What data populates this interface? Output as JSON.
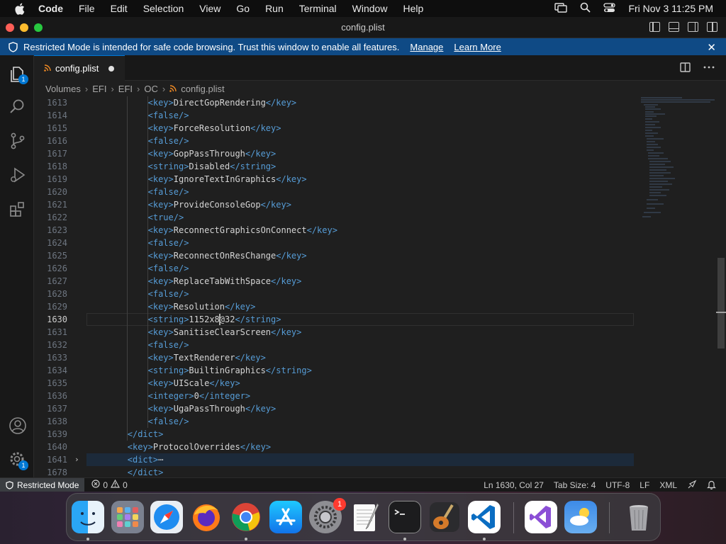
{
  "menubar": {
    "app": "Code",
    "items": [
      "File",
      "Edit",
      "Selection",
      "View",
      "Go",
      "Run",
      "Terminal",
      "Window",
      "Help"
    ],
    "clock": "Fri Nov 3  11:25 PM"
  },
  "window": {
    "title": "config.plist"
  },
  "banner": {
    "message": "Restricted Mode is intended for safe code browsing. Trust this window to enable all features.",
    "manage": "Manage",
    "learn_more": "Learn More"
  },
  "activity": {
    "explorer_badge": "1",
    "settings_badge": "1"
  },
  "tab": {
    "label": "config.plist"
  },
  "breadcrumb": [
    "Volumes",
    "EFI",
    "EFI",
    "OC",
    "config.plist"
  ],
  "editor": {
    "lines": [
      {
        "n": "1613",
        "indent": 3,
        "open": "<key>",
        "text": "DirectGopRendering",
        "close": "</key>"
      },
      {
        "n": "1614",
        "indent": 3,
        "open": "<false/>",
        "text": "",
        "close": ""
      },
      {
        "n": "1615",
        "indent": 3,
        "open": "<key>",
        "text": "ForceResolution",
        "close": "</key>"
      },
      {
        "n": "1616",
        "indent": 3,
        "open": "<false/>",
        "text": "",
        "close": ""
      },
      {
        "n": "1617",
        "indent": 3,
        "open": "<key>",
        "text": "GopPassThrough",
        "close": "</key>"
      },
      {
        "n": "1618",
        "indent": 3,
        "open": "<string>",
        "text": "Disabled",
        "close": "</string>"
      },
      {
        "n": "1619",
        "indent": 3,
        "open": "<key>",
        "text": "IgnoreTextInGraphics",
        "close": "</key>"
      },
      {
        "n": "1620",
        "indent": 3,
        "open": "<false/>",
        "text": "",
        "close": ""
      },
      {
        "n": "1621",
        "indent": 3,
        "open": "<key>",
        "text": "ProvideConsoleGop",
        "close": "</key>"
      },
      {
        "n": "1622",
        "indent": 3,
        "open": "<true/>",
        "text": "",
        "close": ""
      },
      {
        "n": "1623",
        "indent": 3,
        "open": "<key>",
        "text": "ReconnectGraphicsOnConnect",
        "close": "</key>"
      },
      {
        "n": "1624",
        "indent": 3,
        "open": "<false/>",
        "text": "",
        "close": ""
      },
      {
        "n": "1625",
        "indent": 3,
        "open": "<key>",
        "text": "ReconnectOnResChange",
        "close": "</key>"
      },
      {
        "n": "1626",
        "indent": 3,
        "open": "<false/>",
        "text": "",
        "close": ""
      },
      {
        "n": "1627",
        "indent": 3,
        "open": "<key>",
        "text": "ReplaceTabWithSpace",
        "close": "</key>"
      },
      {
        "n": "1628",
        "indent": 3,
        "open": "<false/>",
        "text": "",
        "close": ""
      },
      {
        "n": "1629",
        "indent": 3,
        "open": "<key>",
        "text": "Resolution",
        "close": "</key>"
      },
      {
        "n": "1630",
        "indent": 3,
        "open": "<string>",
        "text": "1152x8@32",
        "close": "</string>"
      },
      {
        "n": "1631",
        "indent": 3,
        "open": "<key>",
        "text": "SanitiseClearScreen",
        "close": "</key>"
      },
      {
        "n": "1632",
        "indent": 3,
        "open": "<false/>",
        "text": "",
        "close": ""
      },
      {
        "n": "1633",
        "indent": 3,
        "open": "<key>",
        "text": "TextRenderer",
        "close": "</key>"
      },
      {
        "n": "1634",
        "indent": 3,
        "open": "<string>",
        "text": "BuiltinGraphics",
        "close": "</string>"
      },
      {
        "n": "1635",
        "indent": 3,
        "open": "<key>",
        "text": "UIScale",
        "close": "</key>"
      },
      {
        "n": "1636",
        "indent": 3,
        "open": "<integer>",
        "text": "0",
        "close": "</integer>"
      },
      {
        "n": "1637",
        "indent": 3,
        "open": "<key>",
        "text": "UgaPassThrough",
        "close": "</key>"
      },
      {
        "n": "1638",
        "indent": 3,
        "open": "<false/>",
        "text": "",
        "close": ""
      },
      {
        "n": "1639",
        "indent": 2,
        "open": "</dict>",
        "text": "",
        "close": ""
      },
      {
        "n": "1640",
        "indent": 2,
        "open": "<key>",
        "text": "ProtocolOverrides",
        "close": "</key>"
      },
      {
        "n": "1641",
        "indent": 2,
        "open": "<dict>",
        "text": "",
        "close": "⋯"
      },
      {
        "n": "1678",
        "indent": 2,
        "open": "</dict>",
        "text": "",
        "close": ""
      }
    ]
  },
  "statusbar": {
    "restricted": "Restricted Mode",
    "errors": "0",
    "warnings": "0",
    "position": "Ln 1630, Col 27",
    "tab_size": "Tab Size: 4",
    "encoding": "UTF-8",
    "eol": "LF",
    "language": "XML"
  },
  "dock": {
    "settings_badge": "1"
  }
}
